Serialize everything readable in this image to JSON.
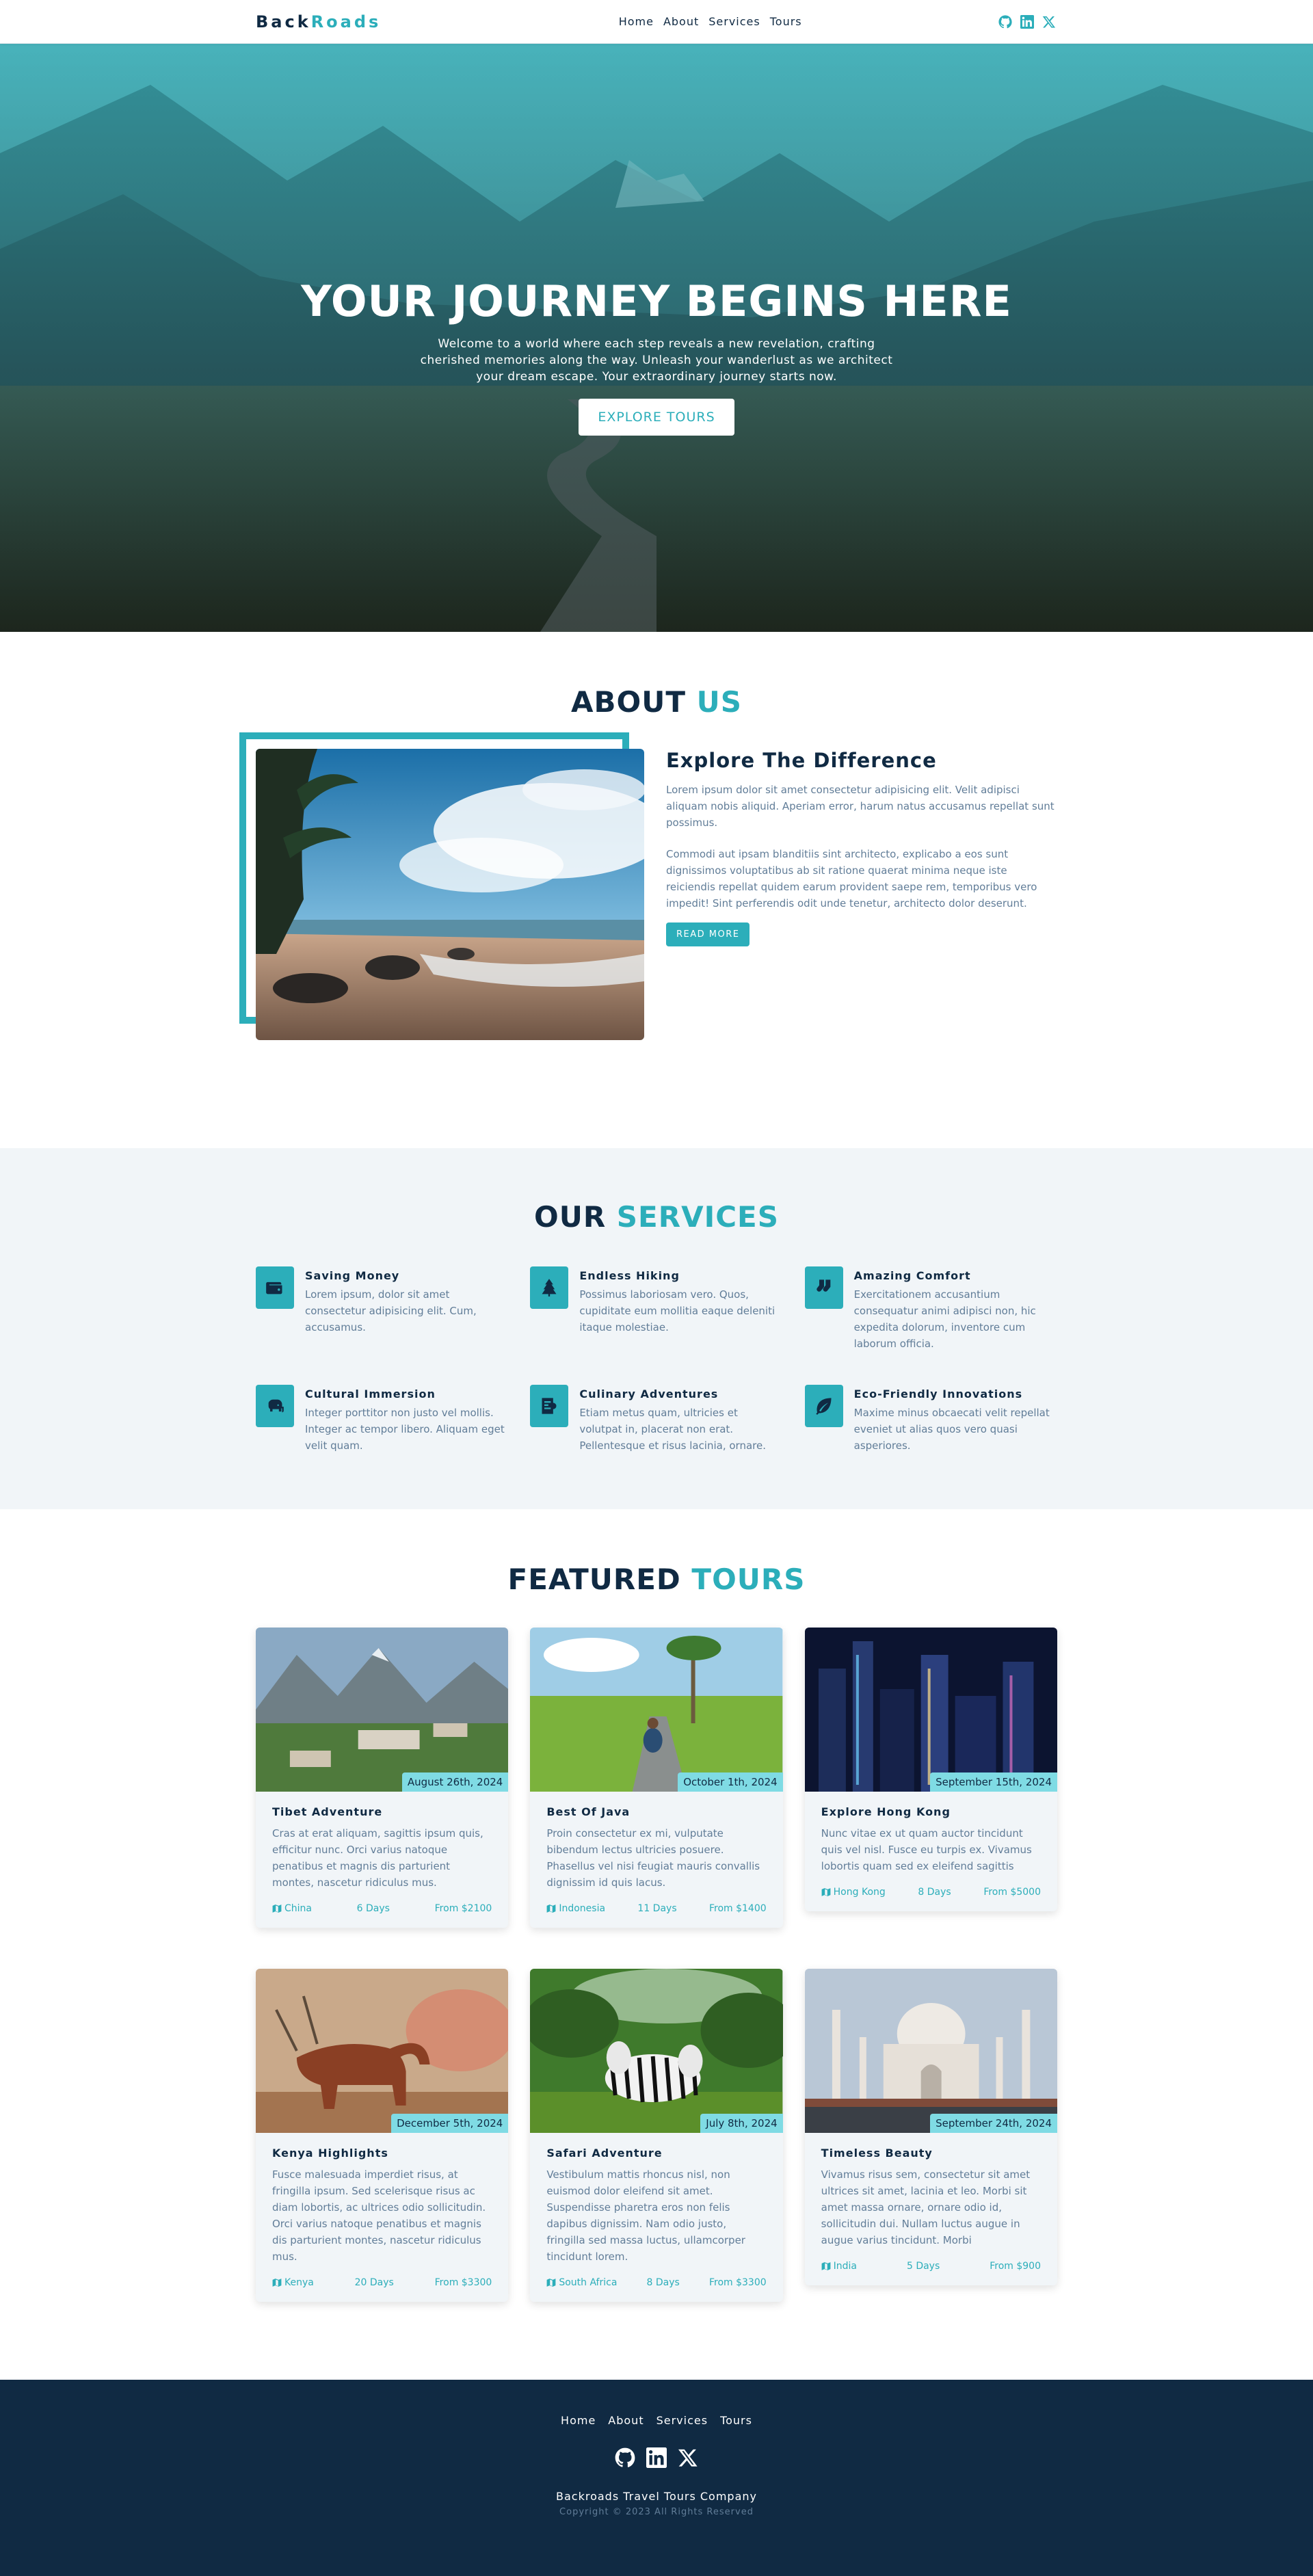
{
  "nav": {
    "logo_part1": "Back",
    "logo_part2": "Roads",
    "links": [
      "Home",
      "About",
      "Services",
      "Tours"
    ],
    "social_icons": [
      "github-icon",
      "linkedin-icon",
      "x-icon"
    ]
  },
  "hero": {
    "title": "YOUR JOURNEY BEGINS HERE",
    "text": "Welcome to a world where each step reveals a new revelation, crafting cherished memories along the way. Unleash your wanderlust as we architect your dream escape. Your extraordinary journey starts now.",
    "button": "EXPLORE TOURS"
  },
  "about": {
    "title_part1": "ABOUT",
    "title_part2": "US",
    "heading": "Explore The Difference",
    "para1": "Lorem ipsum dolor sit amet consectetur adipisicing elit. Velit adipisci aliquam nobis aliquid. Aperiam error, harum natus accusamus repellat sunt possimus.",
    "para2": "Commodi aut ipsam blanditiis sint architecto, explicabo a eos sunt dignissimos voluptatibus ab sit ratione quaerat minima neque iste reiciendis repellat quidem earum provident saepe rem, temporibus vero impedit! Sint perferendis odit unde tenetur, architecto dolor deserunt.",
    "button": "READ MORE"
  },
  "services": {
    "title_part1": "OUR",
    "title_part2": "SERVICES",
    "items": [
      {
        "title": "Saving Money",
        "text": "Lorem ipsum, dolor sit amet consectetur adipisicing elit. Cum, accusamus.",
        "icon": "wallet-icon"
      },
      {
        "title": "Endless Hiking",
        "text": "Possimus laboriosam vero. Quos, cupiditate eum mollitia eaque deleniti itaque molestiae.",
        "icon": "tree-icon"
      },
      {
        "title": "Amazing Comfort",
        "text": "Exercitationem accusantium consequatur animi adipisci non, hic expedita dolorum, inventore cum laborum officia.",
        "icon": "socks-icon"
      },
      {
        "title": "Cultural Immersion",
        "text": "Integer porttitor non justo vel mollis. Integer ac tempor libero. Aliquam eget velit quam.",
        "icon": "elephant-icon"
      },
      {
        "title": "Culinary Adventures",
        "text": "Etiam metus quam, ultricies et volutpat in, placerat non erat. Pellentesque et risus lacinia, ornare.",
        "icon": "menu-icon"
      },
      {
        "title": "Eco-Friendly Innovations",
        "text": "Maxime minus obcaecati velit repellat eveniet ut alias quos vero quasi asperiores.",
        "icon": "leaf-icon"
      }
    ]
  },
  "tours": {
    "title_part1": "FEATURED",
    "title_part2": "TOURS",
    "items": [
      {
        "date": "August 26th, 2024",
        "title": "Tibet Adventure",
        "text": "Cras at erat aliquam, sagittis ipsum quis, efficitur nunc. Orci varius natoque penatibus et magnis dis parturient montes, nascetur ridiculus mus.",
        "location": "China",
        "duration": "6 Days",
        "price": "From $2100"
      },
      {
        "date": "October 1th, 2024",
        "title": "Best Of Java",
        "text": "Proin consectetur ex mi, vulputate bibendum lectus ultricies posuere. Phasellus vel nisi feugiat mauris convallis dignissim id quis lacus.",
        "location": "Indonesia",
        "duration": "11 Days",
        "price": "From $1400"
      },
      {
        "date": "September 15th, 2024",
        "title": "Explore Hong Kong",
        "text": "Nunc vitae ex ut quam auctor tincidunt quis vel nisl. Fusce eu turpis ex. Vivamus lobortis quam sed ex eleifend sagittis",
        "location": "Hong Kong",
        "duration": "8 Days",
        "price": "From $5000"
      },
      {
        "date": "December 5th, 2024",
        "title": "Kenya Highlights",
        "text": "Fusce malesuada imperdiet risus, at fringilla ipsum. Sed scelerisque risus ac diam lobortis, ac ultrices odio sollicitudin. Orci varius natoque penatibus et magnis dis parturient montes, nascetur ridiculus mus.",
        "location": "Kenya",
        "duration": "20 Days",
        "price": "From $3300"
      },
      {
        "date": "July 8th, 2024",
        "title": "Safari Adventure",
        "text": "Vestibulum mattis rhoncus nisl, non euismod dolor eleifend sit amet. Suspendisse pharetra eros non felis dapibus dignissim. Nam odio justo, fringilla sed massa luctus, ullamcorper tincidunt lorem.",
        "location": "South Africa",
        "duration": "8 Days",
        "price": "From $3300"
      },
      {
        "date": "September 24th, 2024",
        "title": "Timeless Beauty",
        "text": "Vivamus risus sem, consectetur sit amet ultrices sit amet, lacinia et leo. Morbi sit amet massa ornare, ornare odio id, sollicitudin dui. Nullam luctus augue in augue varius tincidunt. Morbi",
        "location": "India",
        "duration": "5 Days",
        "price": "From $900"
      }
    ]
  },
  "footer": {
    "links": [
      "Home",
      "About",
      "Services",
      "Tours"
    ],
    "company": "Backroads Travel Tours Company",
    "copyright": "Copyright © 2023 All Rights Reserved"
  },
  "colors": {
    "accent": "#2caeba",
    "accent_light": "#7fdbe4",
    "dark": "#102a43",
    "muted": "#617d98",
    "light_bg": "#f1f5f8"
  }
}
